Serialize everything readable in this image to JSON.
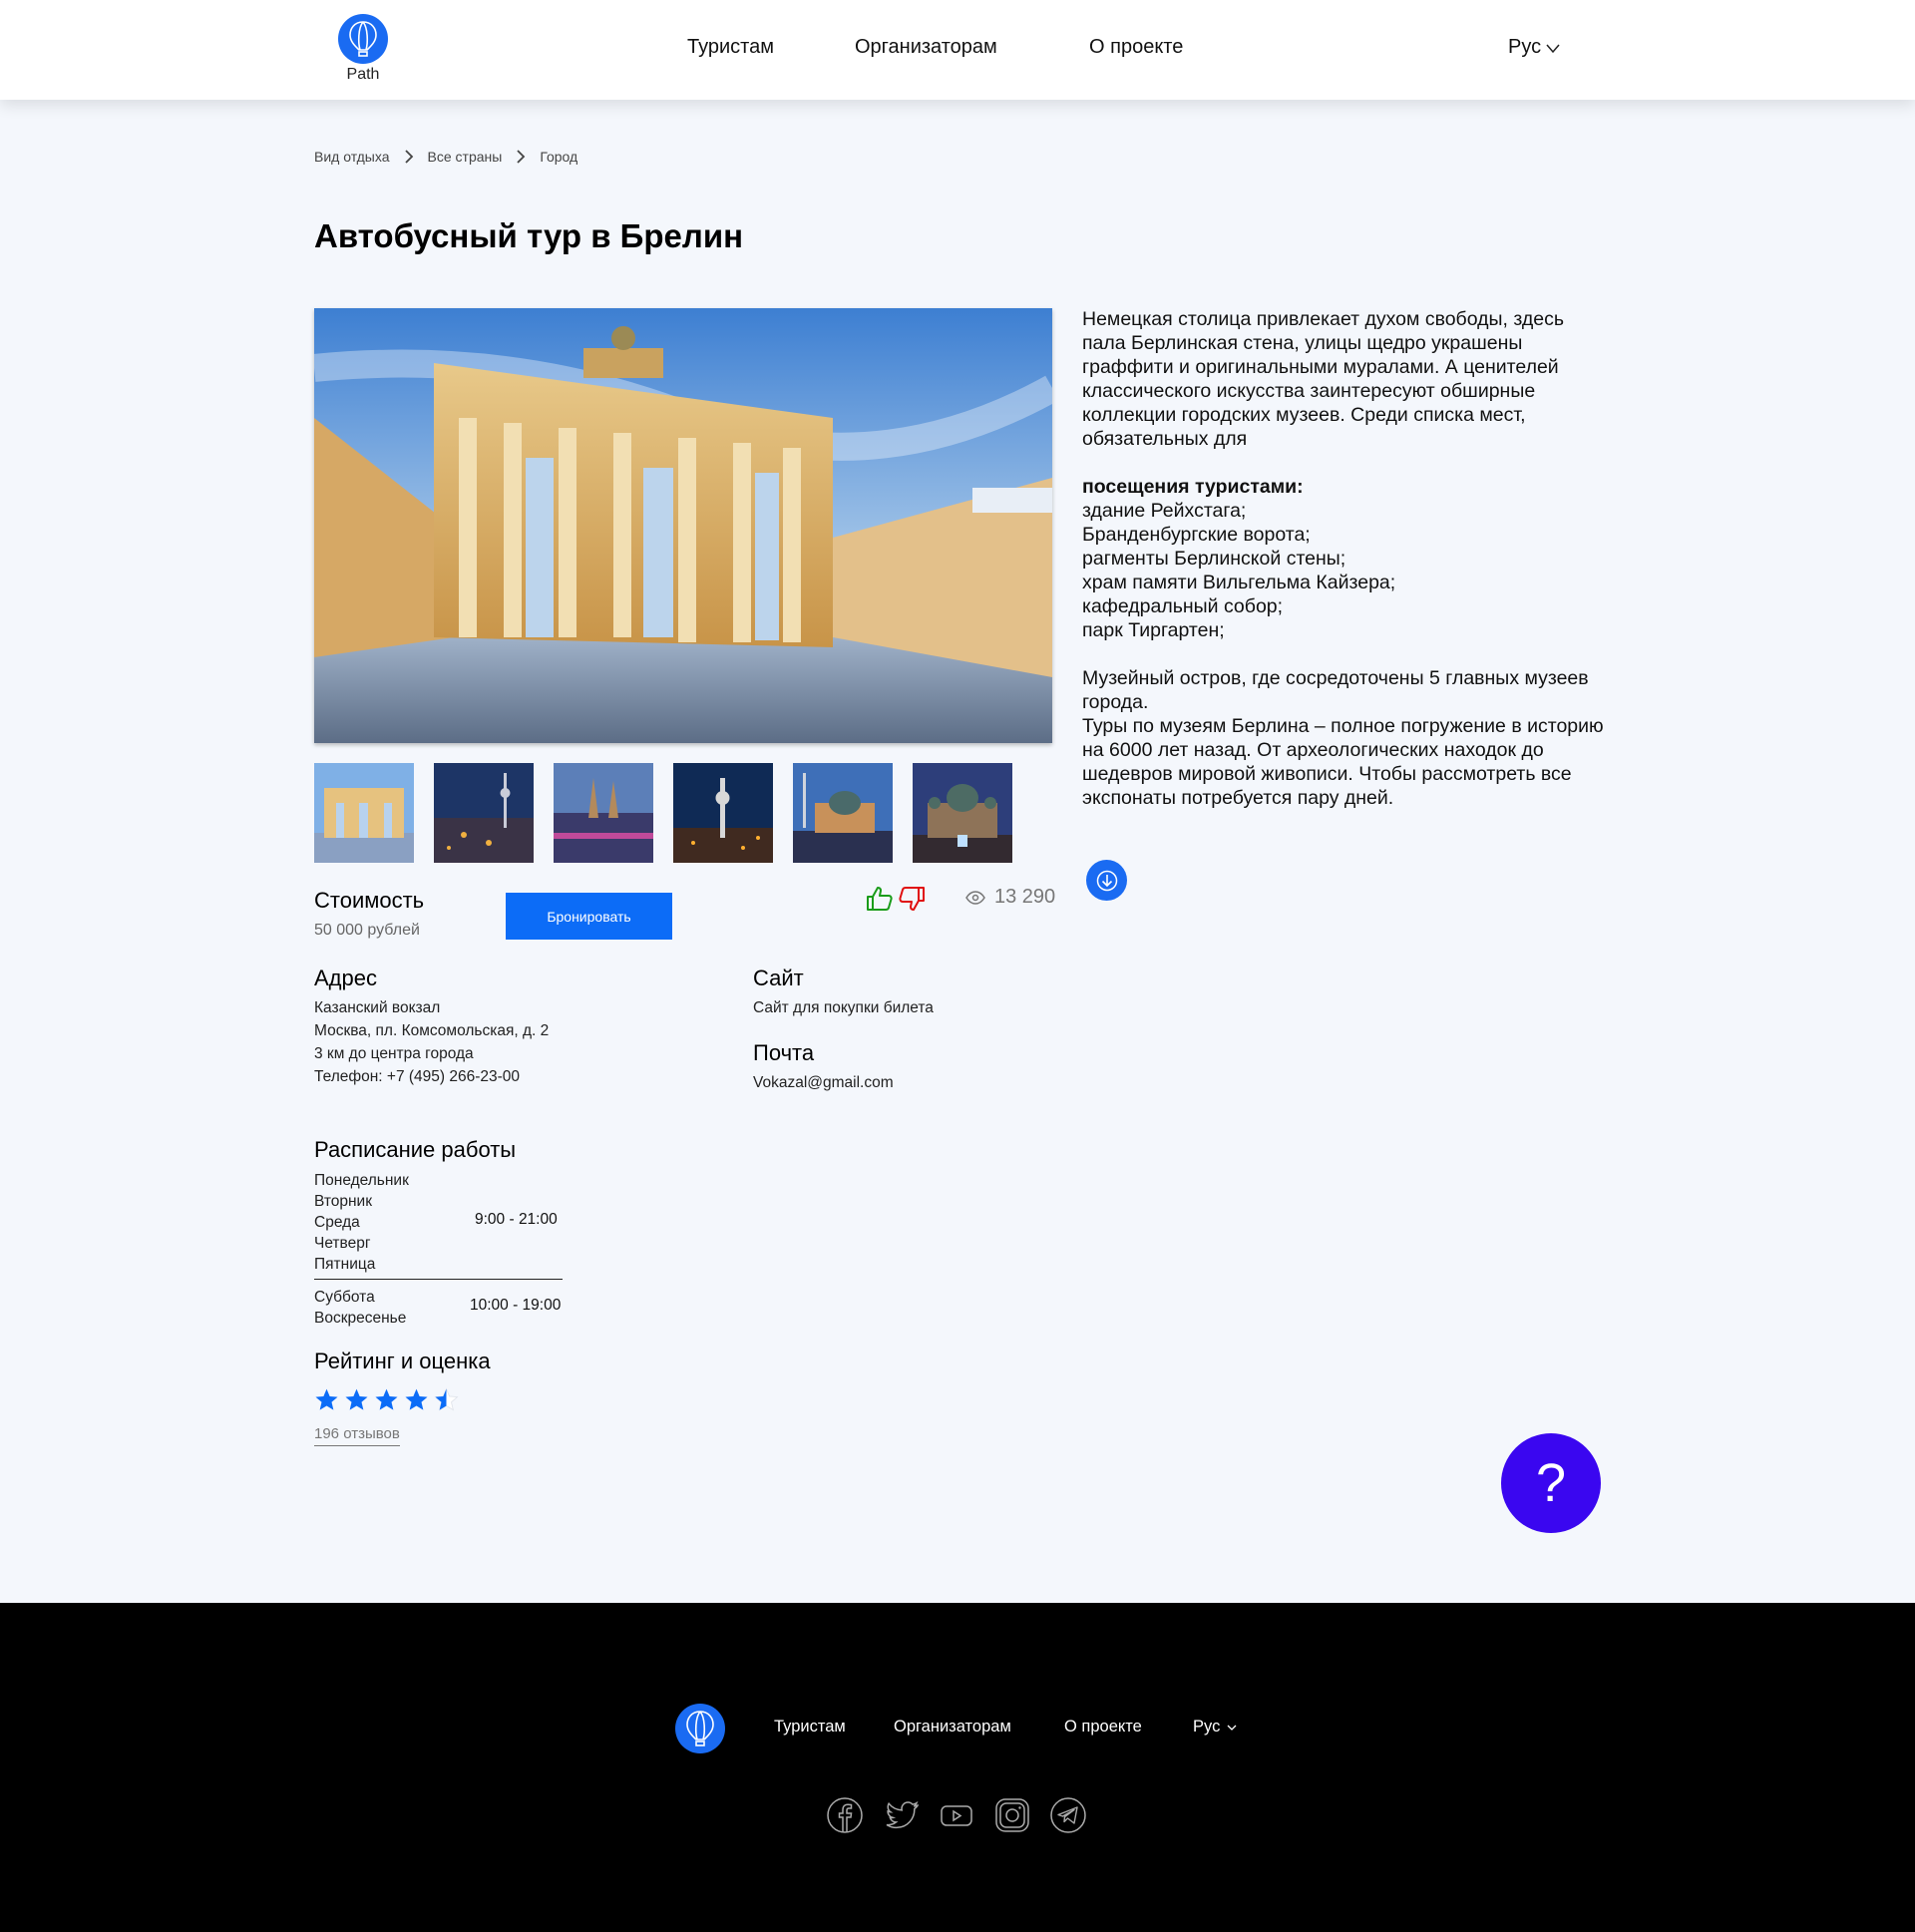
{
  "header": {
    "logo_text": "Path",
    "nav": [
      "Туристам",
      "Организаторам",
      "О проекте"
    ],
    "lang": "Рус"
  },
  "breadcrumb": [
    "Вид отдыха",
    "Все страны",
    "Город"
  ],
  "title": "Автобусный тур в Брелин",
  "description": {
    "p1": "Немецкая столица привлекает духом свободы, здесь пала Берлинская стена, улицы щедро украшены граффити и оригинальными муралами. А ценителей классического искусства заинтересуют обширные коллекции городских музеев. Среди списка мест, обязательных для",
    "p2_bold": "посещения туристами:",
    "list": [
      "здание Рейхстага;",
      "Бранденбургские ворота;",
      "рагменты Берлинской стены;",
      "храм памяти Вильгельма Кайзера;",
      "кафедральный собор;",
      "парк Тиргартен;"
    ],
    "p3": "Музейный остров, где сосредоточены 5 главных музеев города.",
    "p4": "Туры по музеям Берлина – полное погружение в историю на 6000 лет назад. От археологических находок до шедевров мировой живописи. Чтобы рассмотреть все экспонаты потребуется пару дней."
  },
  "price": {
    "label": "Стоимость",
    "value": "50 000 рублей",
    "book": "Бронировать"
  },
  "views": "13 290",
  "address": {
    "title": "Адрес",
    "lines": [
      "Казанский вокзал",
      "Москва, пл. Комсомольская, д. 2",
      "3 км до центра города",
      "Телефон: +7 (495) 266-23-00"
    ]
  },
  "site": {
    "title": "Сайт",
    "value": "Сайт для покупки билета"
  },
  "mail": {
    "title": "Почта",
    "value": "Vokazal@gmail.com"
  },
  "schedule": {
    "title": "Расписание работы",
    "weekdays": [
      "Понедельник",
      "Вторник",
      "Среда",
      "Четверг",
      "Пятница"
    ],
    "weekdays_time": "9:00 - 21:00",
    "weekend": [
      "Суббота",
      "Воскресенье"
    ],
    "weekend_time": "10:00 - 19:00"
  },
  "rating": {
    "title": "Рейтинг и оценка",
    "stars": 4.5,
    "reviews": "196 отзывов"
  },
  "help": "?",
  "footer": {
    "nav": [
      "Туристам",
      "Организаторам",
      "О проекте"
    ],
    "lang": "Рус",
    "social": [
      "facebook-icon",
      "twitter-icon",
      "youtube-icon",
      "instagram-icon",
      "telegram-icon"
    ]
  },
  "colors": {
    "accent": "#0c6cf7",
    "help": "#3a06f0",
    "like": "#1a9c1a",
    "dislike": "#e01010",
    "footer": "#000000",
    "background": "#f4f7fc"
  }
}
